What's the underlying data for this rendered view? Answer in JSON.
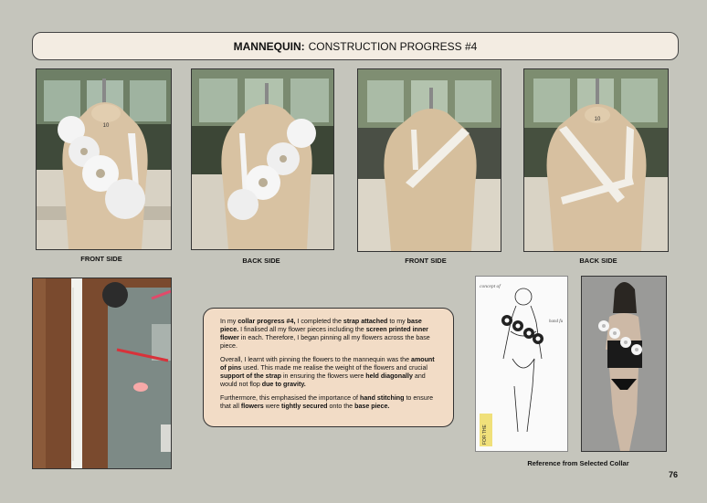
{
  "header": {
    "title_bold": "MANNEQUIN:",
    "title_rest": "CONSTRUCTION PROGRESS #4"
  },
  "captions": {
    "photo1": "FRONT SIDE",
    "photo2": "BACK SIDE",
    "photo3": "FRONT SIDE",
    "photo4": "BACK SIDE",
    "reference": "Reference from Selected Collar"
  },
  "mannequin_size_label": "10",
  "sketch_notes": {
    "top": "concept of",
    "side": "hand fu",
    "bottom": "FOR THE"
  },
  "textbox": {
    "p1": [
      {
        "t": "In my ",
        "b": false
      },
      {
        "t": "collar progress #4,",
        "b": true
      },
      {
        "t": " I completed the ",
        "b": false
      },
      {
        "t": "strap attached",
        "b": true
      },
      {
        "t": " to my ",
        "b": false
      },
      {
        "t": "base piece.",
        "b": true
      },
      {
        "t": " I finalised all my flower pieces including the ",
        "b": false
      },
      {
        "t": "screen printed inner flower",
        "b": true
      },
      {
        "t": " in each. Therefore, I began pinning all my flowers across the base piece.",
        "b": false
      }
    ],
    "p2": [
      {
        "t": "Overall, I learnt with pinning the flowers to the mannequin was the ",
        "b": false
      },
      {
        "t": "amount of pins",
        "b": true
      },
      {
        "t": " used. This made me realise the weight of the flowers and crucial ",
        "b": false
      },
      {
        "t": "support of the strap",
        "b": true
      },
      {
        "t": " in ensuring the flowers were ",
        "b": false
      },
      {
        "t": "held diagonally",
        "b": true
      },
      {
        "t": " and would not flop ",
        "b": false
      },
      {
        "t": "due to gravity.",
        "b": true
      }
    ],
    "p3": [
      {
        "t": "Furthermore, this emphasised the importance of ",
        "b": false
      },
      {
        "t": "hand stitching",
        "b": true
      },
      {
        "t": " to ensure that all ",
        "b": false
      },
      {
        "t": "flowers",
        "b": true
      },
      {
        "t": " were ",
        "b": false
      },
      {
        "t": "tightly secured",
        "b": true
      },
      {
        "t": " onto the ",
        "b": false
      },
      {
        "t": "base piece.",
        "b": true
      }
    ]
  },
  "page_number": "76",
  "colors": {
    "background": "#c5c5bc",
    "header_fill": "#f3ece2",
    "textbox_fill": "#f2dcc6"
  }
}
